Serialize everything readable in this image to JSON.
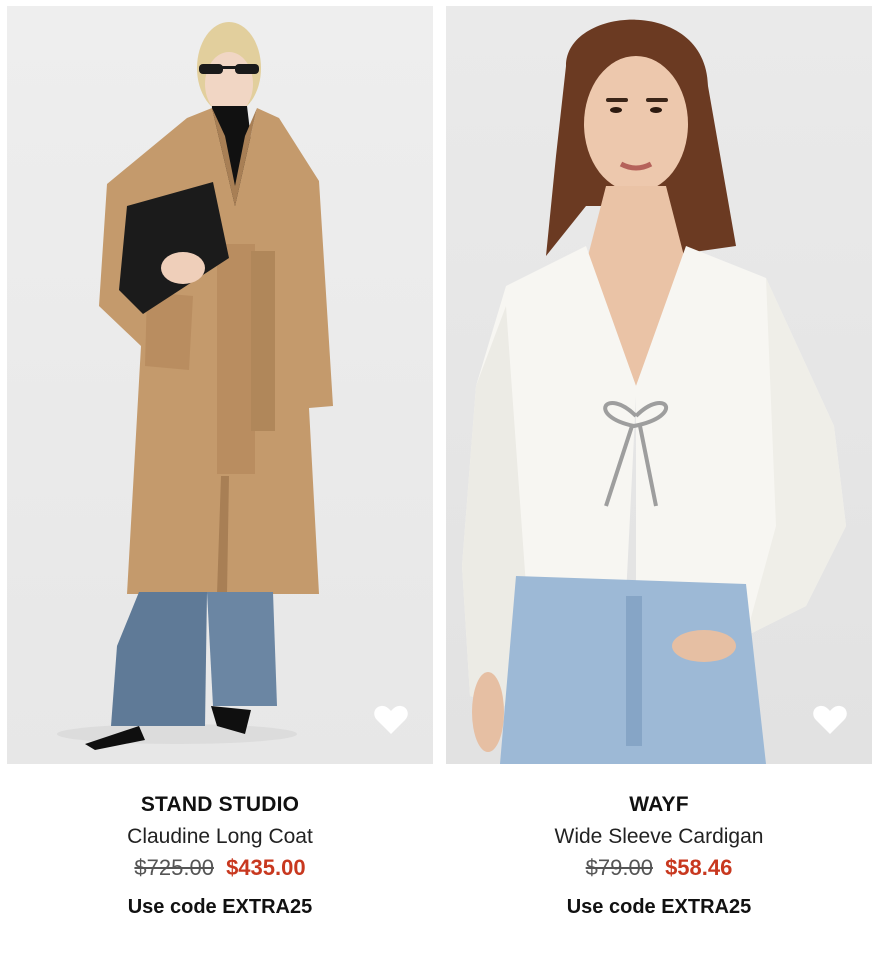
{
  "products": [
    {
      "brand": "STAND STUDIO",
      "name": "Claudine Long Coat",
      "original_price": "$725.00",
      "sale_price": "$435.00",
      "promo": "Use code EXTRA25",
      "image_description_icon": "coat-model-photo"
    },
    {
      "brand": "WAYF",
      "name": "Wide Sleeve Cardigan",
      "original_price": "$79.00",
      "sale_price": "$58.46",
      "promo": "Use code EXTRA25",
      "image_description_icon": "cardigan-model-photo"
    }
  ],
  "colors": {
    "sale": "#c8381f",
    "coat": "#c49a6c",
    "cardigan": "#f7f6f2",
    "denim": "#9db9d6",
    "heart": "#ffffff"
  },
  "icons": {
    "favorite": "heart-icon"
  }
}
